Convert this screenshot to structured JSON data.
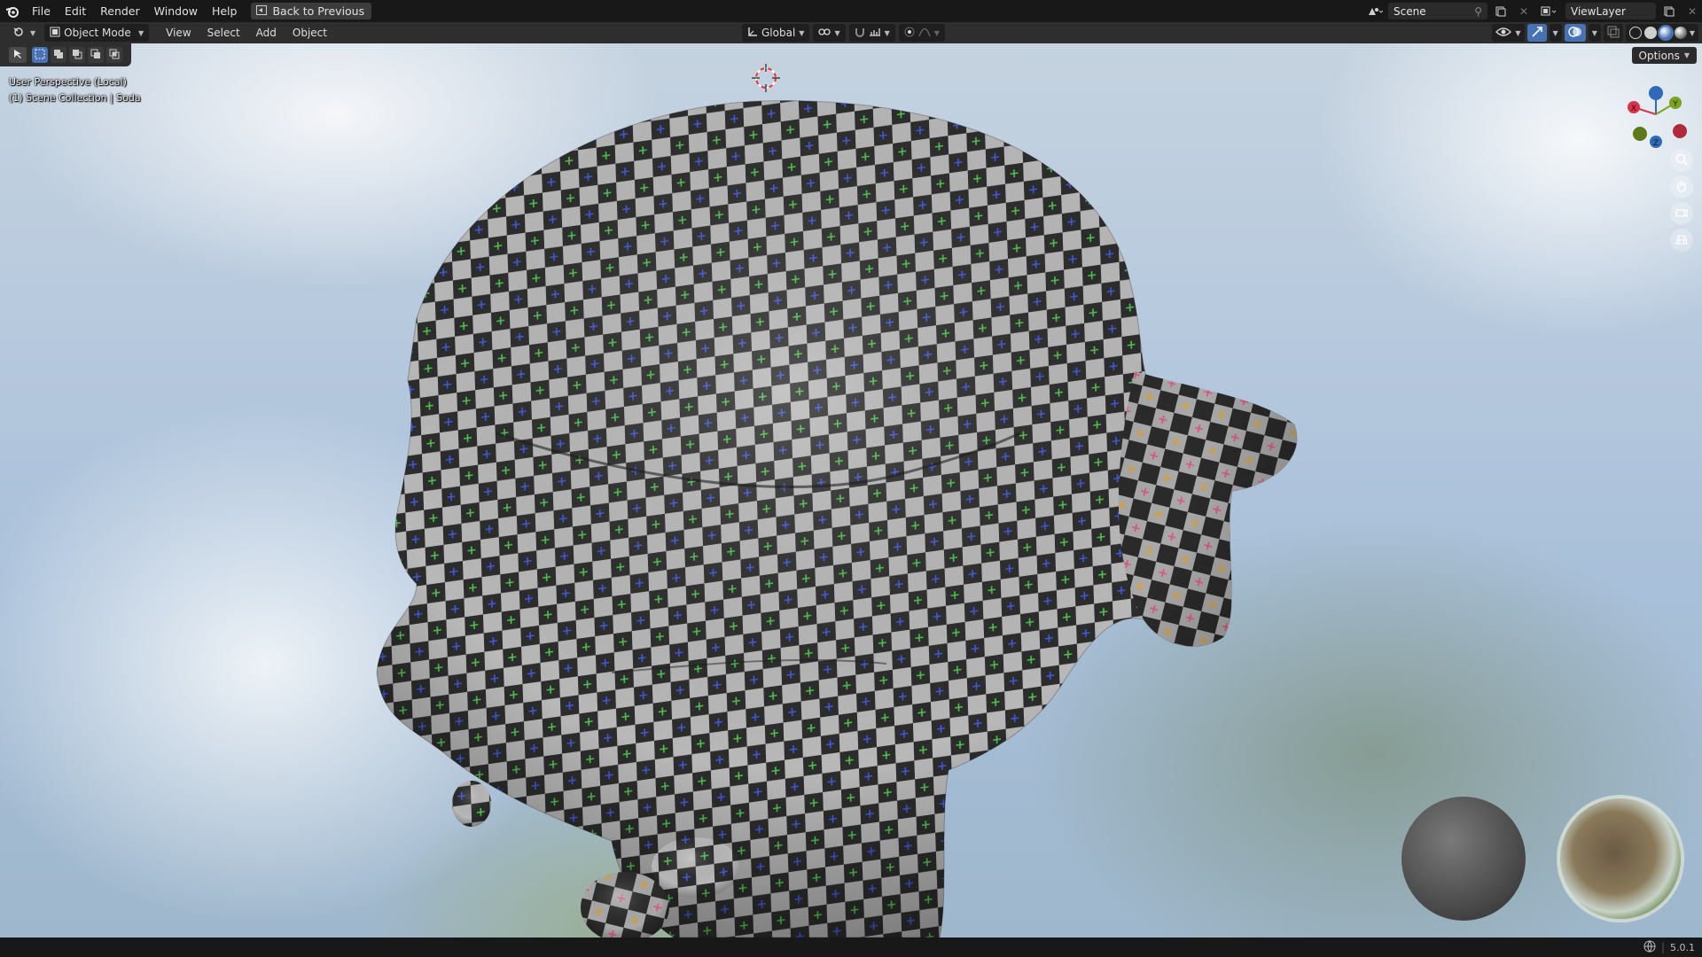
{
  "menubar": {
    "items": [
      "File",
      "Edit",
      "Render",
      "Window",
      "Help"
    ],
    "back_button": "Back to Previous",
    "scene": "Scene",
    "view_layer": "ViewLayer"
  },
  "header": {
    "mode": "Object Mode",
    "menus": [
      "View",
      "Select",
      "Add",
      "Object"
    ],
    "transform_orientation": "Global"
  },
  "viewport": {
    "options_label": "Options",
    "perspective_label": "User Perspective (Local)",
    "collection_label": "(1) Scene Collection | Soda",
    "gizmo_axes": [
      "X",
      "Y",
      "Z"
    ]
  },
  "statusbar": {
    "version": "5.0.1"
  },
  "colors": {
    "accent_blue": "#4772b3",
    "axis_x": "#d5344a",
    "axis_y": "#7ba321",
    "axis_z": "#2f6ab8"
  }
}
